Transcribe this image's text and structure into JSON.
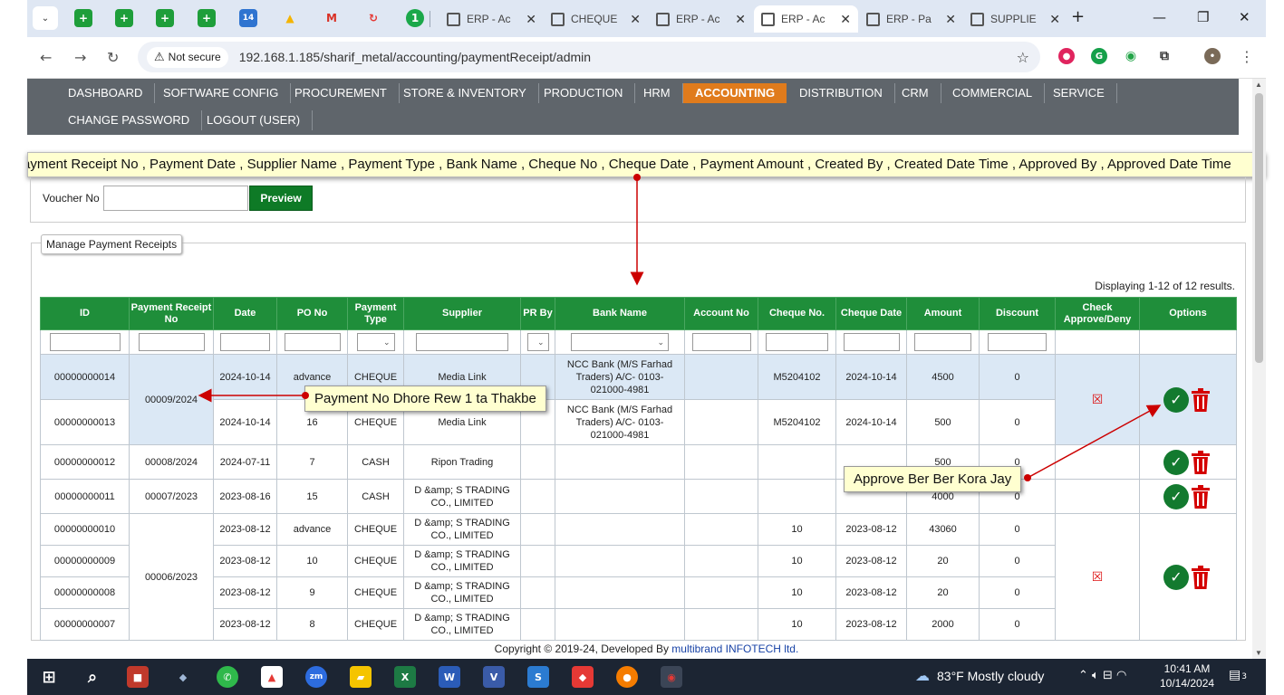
{
  "browser": {
    "tabs": [
      {
        "title": "ERP - Ac"
      },
      {
        "title": "CHEQUE"
      },
      {
        "title": "ERP - Ac"
      },
      {
        "title": "ERP - Ac"
      },
      {
        "title": "ERP - Pa"
      },
      {
        "title": "SUPPLIE"
      }
    ],
    "active_tab_index": 3,
    "security_label": "Not secure",
    "url": "192.168.1.185/sharif_metal/accounting/paymentReceipt/admin",
    "new_tab_glyph": "+"
  },
  "nav": {
    "items": [
      "DASHBOARD",
      "SOFTWARE CONFIG",
      "PROCUREMENT",
      "STORE & INVENTORY",
      "PRODUCTION",
      "HRM",
      "ACCOUNTING",
      "DISTRIBUTION",
      "CRM",
      "COMMERCIAL",
      "SERVICE",
      "CHANGE PASSWORD",
      "LOGOUT (USER)"
    ],
    "active": "ACCOUNTING"
  },
  "column_hint": "ayment Receipt No  , Payment Date  , Supplier Name  , Payment Type  , Bank Name   , Cheque No  , Cheque Date  , Payment Amount , Created By , Created Date Time  , Approved By  , Approved Date Time",
  "voucher": {
    "label": "Voucher No",
    "value": "",
    "button": "Preview"
  },
  "manage": {
    "legend": "Manage Payment Receipts",
    "summary": "Displaying 1-12 of 12 results.",
    "columns": [
      "ID",
      "Payment Receipt No",
      "Date",
      "PO No",
      "Payment Type",
      "Supplier",
      "PR By",
      "Bank Name",
      "Account No",
      "Cheque No.",
      "Cheque Date",
      "Amount",
      "Discount",
      "Check Approve/Deny",
      "Options"
    ],
    "rows": [
      {
        "id": "00000000014",
        "date": "2024-10-14",
        "po": "advance",
        "type": "CHEQUE",
        "supplier": "Media Link",
        "bank": "NCC Bank (M/S Farhad Traders) A/C- 0103-021000-4981",
        "account": "",
        "cheque_no": "M5204102",
        "cheque_date": "2024-10-14",
        "amount": "4500",
        "discount": "0"
      },
      {
        "id": "00000000013",
        "date": "2024-10-14",
        "po": "16",
        "type": "CHEQUE",
        "supplier": "Media Link",
        "bank": "NCC Bank (M/S Farhad Traders) A/C- 0103-021000-4981",
        "account": "",
        "cheque_no": "M5204102",
        "cheque_date": "2024-10-14",
        "amount": "500",
        "discount": "0"
      },
      {
        "id": "00000000012",
        "receipt": "00008/2024",
        "date": "2024-07-11",
        "po": "7",
        "type": "CASH",
        "supplier": "Ripon Trading",
        "bank": "",
        "account": "",
        "cheque_no": "",
        "cheque_date": "",
        "amount": "500",
        "discount": "0"
      },
      {
        "id": "00000000011",
        "receipt": "00007/2023",
        "date": "2023-08-16",
        "po": "15",
        "type": "CASH",
        "supplier": "D &amp; S TRADING CO., LIMITED",
        "bank": "",
        "account": "",
        "cheque_no": "",
        "cheque_date": "",
        "amount": "4000",
        "discount": "0"
      },
      {
        "id": "00000000010",
        "date": "2023-08-12",
        "po": "advance",
        "type": "CHEQUE",
        "supplier": "D &amp; S TRADING CO., LIMITED",
        "bank": "",
        "account": "",
        "cheque_no": "10",
        "cheque_date": "2023-08-12",
        "amount": "43060",
        "discount": "0"
      },
      {
        "id": "00000000009",
        "date": "2023-08-12",
        "po": "10",
        "type": "CHEQUE",
        "supplier": "D &amp; S TRADING CO., LIMITED",
        "bank": "",
        "account": "",
        "cheque_no": "10",
        "cheque_date": "2023-08-12",
        "amount": "20",
        "discount": "0"
      },
      {
        "id": "00000000008",
        "date": "2023-08-12",
        "po": "9",
        "type": "CHEQUE",
        "supplier": "D &amp; S TRADING CO., LIMITED",
        "bank": "",
        "account": "",
        "cheque_no": "10",
        "cheque_date": "2023-08-12",
        "amount": "20",
        "discount": "0"
      },
      {
        "id": "00000000007",
        "date": "2023-08-12",
        "po": "8",
        "type": "CHEQUE",
        "supplier": "D &amp; S TRADING CO., LIMITED",
        "bank": "",
        "account": "",
        "cheque_no": "10",
        "cheque_date": "2023-08-12",
        "amount": "2000",
        "discount": "0"
      }
    ],
    "groups": {
      "receipt_2024": "00009/2024",
      "receipt_2023": "00006/2023"
    }
  },
  "annotations": {
    "row_note": "Payment No Dhore Rew 1 ta Thakbe",
    "approve_note": "Approve Ber Ber Kora Jay"
  },
  "footer": {
    "prefix": "Copyright © 2019-24, Developed By ",
    "link": "multibrand INFOTECH ltd."
  },
  "taskbar": {
    "weather": "83°F  Mostly cloudy",
    "time": "10:41 AM",
    "date": "10/14/2024",
    "notification_count": "3"
  }
}
